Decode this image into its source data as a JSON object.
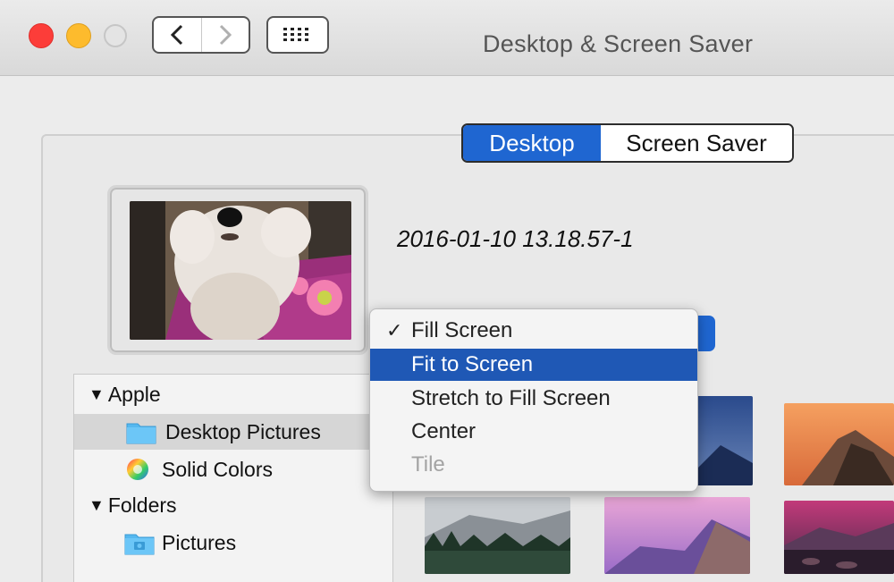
{
  "window": {
    "title": "Desktop & Screen Saver"
  },
  "toolbar": {
    "back_icon": "chevron-left-icon",
    "forward_icon": "chevron-right-icon",
    "grid_icon": "grid-icon"
  },
  "tabs": {
    "desktop": "Desktop",
    "screen_saver": "Screen Saver"
  },
  "current": {
    "filename": "2016-01-10 13.18.57-1"
  },
  "sidebar": {
    "groups": [
      {
        "label": "Apple",
        "items": [
          "Desktop Pictures",
          "Solid Colors"
        ]
      },
      {
        "label": "Folders",
        "items": [
          "Pictures"
        ]
      }
    ],
    "selected": "Desktop Pictures"
  },
  "menu": {
    "items": [
      {
        "label": "Fill Screen",
        "checked": true
      },
      {
        "label": "Fit to Screen",
        "highlighted": true
      },
      {
        "label": "Stretch to Fill Screen"
      },
      {
        "label": "Center"
      },
      {
        "label": "Tile",
        "disabled": true
      }
    ]
  },
  "colors": {
    "accent": "#1f66d1",
    "highlight": "#1f58b5",
    "close": "#fc3d39",
    "minimize": "#fdbb2d"
  }
}
